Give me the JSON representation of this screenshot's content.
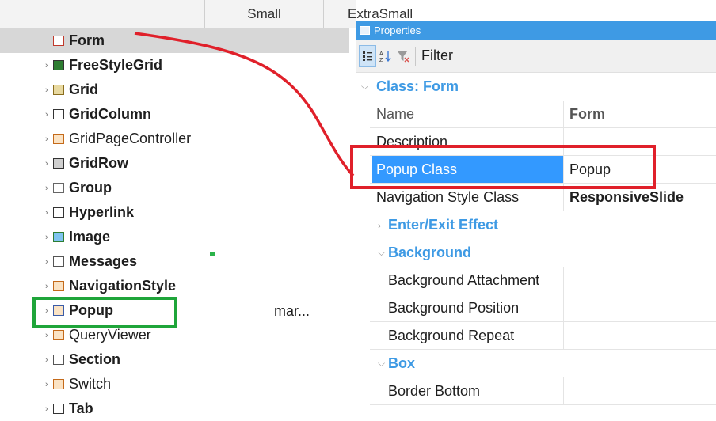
{
  "header": {
    "columns": [
      "Small",
      "ExtraSmall"
    ]
  },
  "tree": {
    "items": [
      {
        "label": "Form",
        "bold": true,
        "icon": "form-icon",
        "selected": true
      },
      {
        "label": "FreeStyleGrid",
        "bold": true,
        "icon": "freestylegrid-icon"
      },
      {
        "label": "Grid",
        "bold": true,
        "icon": "grid-icon"
      },
      {
        "label": "GridColumn",
        "bold": true,
        "icon": "gridcolumn-icon"
      },
      {
        "label": "GridPageController",
        "bold": false,
        "icon": "gridpagecontroller-icon"
      },
      {
        "label": "GridRow",
        "bold": true,
        "icon": "gridrow-icon"
      },
      {
        "label": "Group",
        "bold": true,
        "icon": "group-icon"
      },
      {
        "label": "Hyperlink",
        "bold": true,
        "icon": "hyperlink-icon"
      },
      {
        "label": "Image",
        "bold": true,
        "icon": "image-icon"
      },
      {
        "label": "Messages",
        "bold": true,
        "icon": "messages-icon"
      },
      {
        "label": "NavigationStyle",
        "bold": true,
        "icon": "navigationstyle-icon"
      },
      {
        "label": "Popup",
        "bold": true,
        "icon": "popup-icon"
      },
      {
        "label": "QueryViewer",
        "bold": false,
        "icon": "queryviewer-icon"
      },
      {
        "label": "Section",
        "bold": true,
        "icon": "section-icon"
      },
      {
        "label": "Switch",
        "bold": false,
        "icon": "switch-icon"
      },
      {
        "label": "Tab",
        "bold": true,
        "icon": "tab-icon"
      }
    ],
    "extra_text": "mar..."
  },
  "properties": {
    "title": "Properties",
    "toolbar": {
      "filter_label": "Filter"
    },
    "class_header": "Class: Form",
    "rows": [
      {
        "name": "Name",
        "value": "Form",
        "value_bold": true,
        "muted": true
      },
      {
        "name": "Description",
        "value": ""
      },
      {
        "name": "Popup Class",
        "value": "Popup",
        "selected": true
      },
      {
        "name": "Navigation Style Class",
        "value": "ResponsiveSlide",
        "value_bold": true
      }
    ],
    "categories": {
      "enter_exit": "Enter/Exit Effect",
      "background": "Background",
      "box": "Box"
    },
    "background_rows": [
      "Background Attachment",
      "Background Position",
      "Background Repeat"
    ],
    "box_rows": [
      "Border Bottom"
    ]
  },
  "annotation_colors": {
    "red": "#e0202a",
    "green": "#1fa53a"
  }
}
